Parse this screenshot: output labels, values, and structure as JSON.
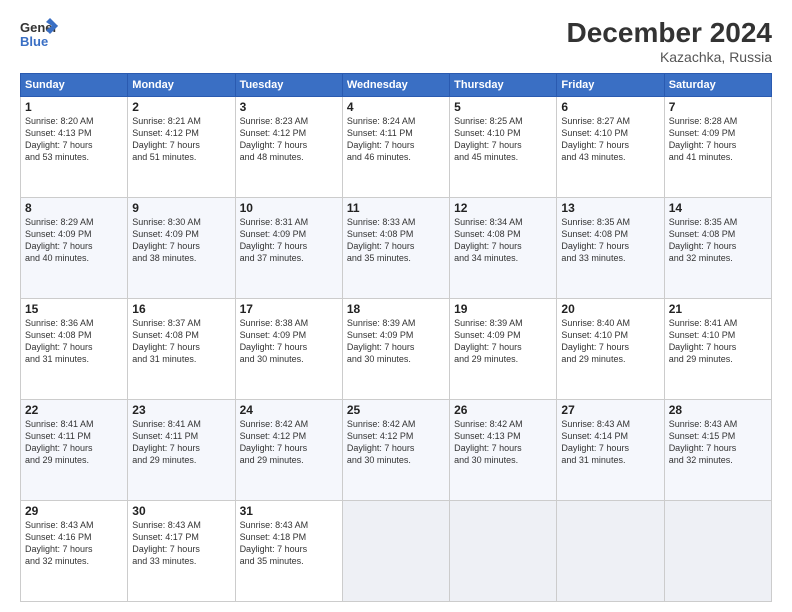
{
  "header": {
    "logo_line1": "General",
    "logo_line2": "Blue",
    "title": "December 2024",
    "subtitle": "Kazachka, Russia"
  },
  "weekdays": [
    "Sunday",
    "Monday",
    "Tuesday",
    "Wednesday",
    "Thursday",
    "Friday",
    "Saturday"
  ],
  "weeks": [
    [
      {
        "day": "1",
        "sunrise": "8:20 AM",
        "sunset": "4:13 PM",
        "daylight": "7 hours and 53 minutes."
      },
      {
        "day": "2",
        "sunrise": "8:21 AM",
        "sunset": "4:12 PM",
        "daylight": "7 hours and 51 minutes."
      },
      {
        "day": "3",
        "sunrise": "8:23 AM",
        "sunset": "4:12 PM",
        "daylight": "7 hours and 48 minutes."
      },
      {
        "day": "4",
        "sunrise": "8:24 AM",
        "sunset": "4:11 PM",
        "daylight": "7 hours and 46 minutes."
      },
      {
        "day": "5",
        "sunrise": "8:25 AM",
        "sunset": "4:10 PM",
        "daylight": "7 hours and 45 minutes."
      },
      {
        "day": "6",
        "sunrise": "8:27 AM",
        "sunset": "4:10 PM",
        "daylight": "7 hours and 43 minutes."
      },
      {
        "day": "7",
        "sunrise": "8:28 AM",
        "sunset": "4:09 PM",
        "daylight": "7 hours and 41 minutes."
      }
    ],
    [
      {
        "day": "8",
        "sunrise": "8:29 AM",
        "sunset": "4:09 PM",
        "daylight": "7 hours and 40 minutes."
      },
      {
        "day": "9",
        "sunrise": "8:30 AM",
        "sunset": "4:09 PM",
        "daylight": "7 hours and 38 minutes."
      },
      {
        "day": "10",
        "sunrise": "8:31 AM",
        "sunset": "4:09 PM",
        "daylight": "7 hours and 37 minutes."
      },
      {
        "day": "11",
        "sunrise": "8:33 AM",
        "sunset": "4:08 PM",
        "daylight": "7 hours and 35 minutes."
      },
      {
        "day": "12",
        "sunrise": "8:34 AM",
        "sunset": "4:08 PM",
        "daylight": "7 hours and 34 minutes."
      },
      {
        "day": "13",
        "sunrise": "8:35 AM",
        "sunset": "4:08 PM",
        "daylight": "7 hours and 33 minutes."
      },
      {
        "day": "14",
        "sunrise": "8:35 AM",
        "sunset": "4:08 PM",
        "daylight": "7 hours and 32 minutes."
      }
    ],
    [
      {
        "day": "15",
        "sunrise": "8:36 AM",
        "sunset": "4:08 PM",
        "daylight": "7 hours and 31 minutes."
      },
      {
        "day": "16",
        "sunrise": "8:37 AM",
        "sunset": "4:08 PM",
        "daylight": "7 hours and 31 minutes."
      },
      {
        "day": "17",
        "sunrise": "8:38 AM",
        "sunset": "4:09 PM",
        "daylight": "7 hours and 30 minutes."
      },
      {
        "day": "18",
        "sunrise": "8:39 AM",
        "sunset": "4:09 PM",
        "daylight": "7 hours and 30 minutes."
      },
      {
        "day": "19",
        "sunrise": "8:39 AM",
        "sunset": "4:09 PM",
        "daylight": "7 hours and 29 minutes."
      },
      {
        "day": "20",
        "sunrise": "8:40 AM",
        "sunset": "4:10 PM",
        "daylight": "7 hours and 29 minutes."
      },
      {
        "day": "21",
        "sunrise": "8:41 AM",
        "sunset": "4:10 PM",
        "daylight": "7 hours and 29 minutes."
      }
    ],
    [
      {
        "day": "22",
        "sunrise": "8:41 AM",
        "sunset": "4:11 PM",
        "daylight": "7 hours and 29 minutes."
      },
      {
        "day": "23",
        "sunrise": "8:41 AM",
        "sunset": "4:11 PM",
        "daylight": "7 hours and 29 minutes."
      },
      {
        "day": "24",
        "sunrise": "8:42 AM",
        "sunset": "4:12 PM",
        "daylight": "7 hours and 29 minutes."
      },
      {
        "day": "25",
        "sunrise": "8:42 AM",
        "sunset": "4:12 PM",
        "daylight": "7 hours and 30 minutes."
      },
      {
        "day": "26",
        "sunrise": "8:42 AM",
        "sunset": "4:13 PM",
        "daylight": "7 hours and 30 minutes."
      },
      {
        "day": "27",
        "sunrise": "8:43 AM",
        "sunset": "4:14 PM",
        "daylight": "7 hours and 31 minutes."
      },
      {
        "day": "28",
        "sunrise": "8:43 AM",
        "sunset": "4:15 PM",
        "daylight": "7 hours and 32 minutes."
      }
    ],
    [
      {
        "day": "29",
        "sunrise": "8:43 AM",
        "sunset": "4:16 PM",
        "daylight": "7 hours and 32 minutes."
      },
      {
        "day": "30",
        "sunrise": "8:43 AM",
        "sunset": "4:17 PM",
        "daylight": "7 hours and 33 minutes."
      },
      {
        "day": "31",
        "sunrise": "8:43 AM",
        "sunset": "4:18 PM",
        "daylight": "7 hours and 35 minutes."
      },
      null,
      null,
      null,
      null
    ]
  ]
}
